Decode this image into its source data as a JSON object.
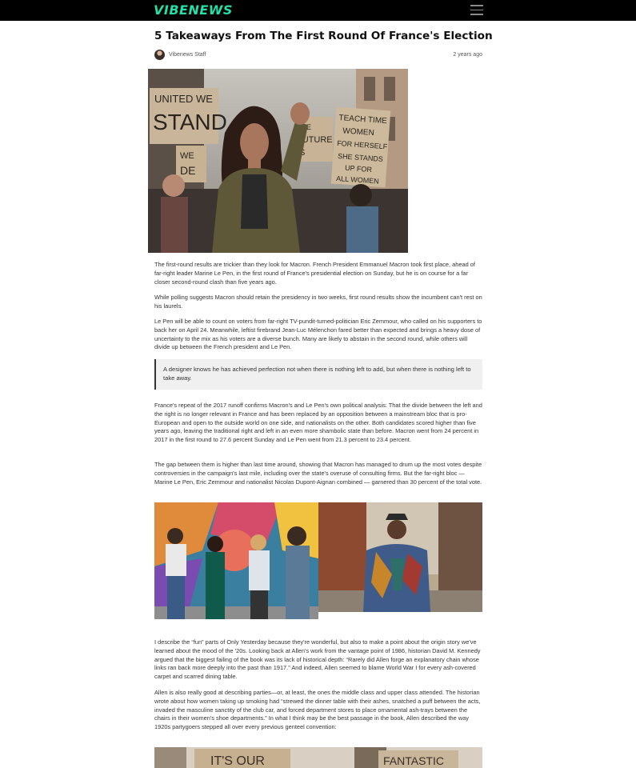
{
  "header": {
    "logo": "VIBENEWS",
    "menu_icon": "hamburger-menu-icon"
  },
  "article": {
    "title": "5 Takeaways From The First Round Of France's Election",
    "author": "Vibenews Staff",
    "time": "2 years ago",
    "paragraphs": [
      "The first-round results are trickier than they look for Macron. French President Emmanuel Macron took first place, ahead of far-right leader Marine Le Pen, in the first round of France's presidential election on Sunday, but he is on course for a far closer second-round clash than five years ago.",
      "While polling suggests Macron should retain the presidency in two weeks, first round results show the incumbent can't rest on his laurels.",
      "Le Pen will be able to count on voters from far-right TV-pundit-turned-politician Eric Zemmour, who called on his supporters to back her on April 24. Meanwhile, leftist firebrand Jean-Luc Mélenchon fared better than expected and brings a heavy dose of uncertainty to the mix as his voters are a diverse bunch. Many are likely to abstain in the second round, while others will divide up between the French president and Le Pen.",
      "France's repeat of the 2017 runoff confirms Macron's and Le Pen's own political analysis: That the divide between the left and the right is no longer relevant in France and has been replaced by an opposition between a mainstream bloc that is pro-European and open to the outside world on one side, and nationalists on the other. Both candidates scored higher than five years ago, leaving the traditional right and left in an even more shambolic state than before. Macron went from 24 percent in 2017 in the first round to 27.6 percent Sunday and Le Pen went from 21.3 percent to 23.4 percent.",
      "The gap between them is higher than last time around, showing that Macron has managed to drum up the most votes despite controversies in the campaign's last mile, including over the state's overuse of consulting firms. But the far-right bloc — Marine Le Pen, Eric Zemmour and nationalist Nicolas Dupont-Aignan combined — garnered than 30 percent of the total vote.",
      "I describe the “fun” parts of Only Yesterday because they're wonderful, but also to make a point about the origin story we've learned about the mood of the '20s. Looking back at Allen's work from the vantage point of 1986, historian David M. Kennedy argued that the biggest failing of the book was its lack of historical depth: “Rarely did Allen forge an explanatory chain whose links ran back more deeply into the past than 1917.” And indeed, Allen seemed to blame World War I for every ash-covered carpet and scarred dining table.",
      "Allen is also really good at describing parties—or, at least, the ones the middle class and upper class attended. The historian wrote about how women taking up smoking had “strewed the dinner table with their ashes, snatched a puff between the acts, invaded the masculine sanctity of the club car, and forced department stores to place ornamental ash-trays between the chairs in their women's shoe departments.” In what I think may be the best passage in the book, Allen described the way 1920s partygoers stepped all over every previous genteel convention:"
    ],
    "quote": "A designer knows he has achieved perfection not when there is nothing left to add, but when there is nothing left to take away.",
    "hero_sign_texts": [
      "UNITED WE",
      "STAND.",
      "WE",
      "DE",
      "TEACH TIME",
      "WOMEN",
      "FOR HERSELF",
      "SHE STANDS",
      "UP FOR",
      "ALL WOMEN",
      "THE",
      "FUTURE",
      "IS",
      "FE"
    ],
    "bottom_sign_texts": [
      "IT'S OUR",
      "FANTASTIC"
    ]
  },
  "colors": {
    "header_bg": "#000000",
    "logo": "#22e0a8",
    "quote_bg": "#f0f0f0",
    "text": "#333333"
  }
}
